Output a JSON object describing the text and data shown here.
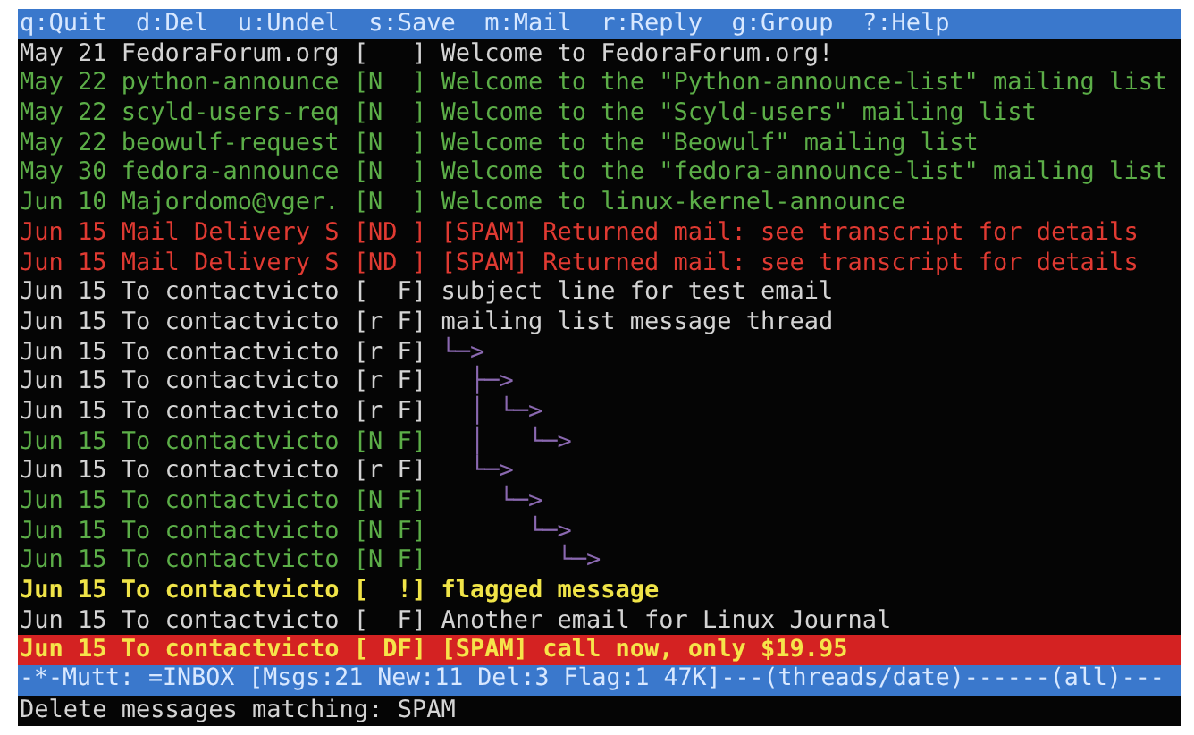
{
  "help_bar": [
    "q:Quit",
    "d:Del",
    "u:Undel",
    "s:Save",
    "m:Mail",
    "r:Reply",
    "g:Group",
    "?:Help"
  ],
  "messages": [
    {
      "date": "May 21",
      "from": "FedoraForum.org",
      "flags": "[   ]",
      "subject": "Welcome to FedoraForum.org!",
      "kind": "normal",
      "selected": false
    },
    {
      "date": "May 22",
      "from": "python-announce",
      "flags": "[N  ]",
      "subject": "Welcome to the \"Python-announce-list\" mailing list",
      "kind": "new",
      "selected": false
    },
    {
      "date": "May 22",
      "from": "scyld-users-req",
      "flags": "[N  ]",
      "subject": "Welcome to the \"Scyld-users\" mailing list",
      "kind": "new",
      "selected": false
    },
    {
      "date": "May 22",
      "from": "beowulf-request",
      "flags": "[N  ]",
      "subject": "Welcome to the \"Beowulf\" mailing list",
      "kind": "new",
      "selected": false
    },
    {
      "date": "May 30",
      "from": "fedora-announce",
      "flags": "[N  ]",
      "subject": "Welcome to the \"fedora-announce-list\" mailing list",
      "kind": "new",
      "selected": false
    },
    {
      "date": "Jun 10",
      "from": "Majordomo@vger.",
      "flags": "[N  ]",
      "subject": "Welcome to linux-kernel-announce",
      "kind": "new",
      "selected": false
    },
    {
      "date": "Jun 15",
      "from": "Mail Delivery S",
      "flags": "[ND ]",
      "subject": "[SPAM] Returned mail: see transcript for details",
      "kind": "deleted",
      "selected": false
    },
    {
      "date": "Jun 15",
      "from": "Mail Delivery S",
      "flags": "[ND ]",
      "subject": "[SPAM] Returned mail: see transcript for details",
      "kind": "deleted",
      "selected": false
    },
    {
      "date": "Jun 15",
      "from": "To contactvicto",
      "flags": "[  F]",
      "subject": "subject line for test email",
      "kind": "normal",
      "selected": false
    },
    {
      "date": "Jun 15",
      "from": "To contactvicto",
      "flags": "[r F]",
      "subject": "mailing list message thread",
      "kind": "normal",
      "selected": false
    },
    {
      "date": "Jun 15",
      "from": "To contactvicto",
      "flags": "[r F]",
      "tree": "└─>",
      "kind": "normal",
      "selected": false
    },
    {
      "date": "Jun 15",
      "from": "To contactvicto",
      "flags": "[r F]",
      "tree": "  ├─>",
      "kind": "normal",
      "selected": false
    },
    {
      "date": "Jun 15",
      "from": "To contactvicto",
      "flags": "[r F]",
      "tree": "  │ └─>",
      "kind": "normal",
      "selected": false
    },
    {
      "date": "Jun 15",
      "from": "To contactvicto",
      "flags": "[N F]",
      "tree": "  │   └─>",
      "kind": "new",
      "selected": false
    },
    {
      "date": "Jun 15",
      "from": "To contactvicto",
      "flags": "[r F]",
      "tree": "  └─>",
      "kind": "normal",
      "selected": false
    },
    {
      "date": "Jun 15",
      "from": "To contactvicto",
      "flags": "[N F]",
      "tree": "    └─>",
      "kind": "new",
      "selected": false
    },
    {
      "date": "Jun 15",
      "from": "To contactvicto",
      "flags": "[N F]",
      "tree": "      └─>",
      "kind": "new",
      "selected": false
    },
    {
      "date": "Jun 15",
      "from": "To contactvicto",
      "flags": "[N F]",
      "tree": "        └─>",
      "kind": "new",
      "selected": false
    },
    {
      "date": "Jun 15",
      "from": "To contactvicto",
      "flags": "[  !]",
      "subject": "flagged message",
      "kind": "flagged",
      "selected": false
    },
    {
      "date": "Jun 15",
      "from": "To contactvicto",
      "flags": "[  F]",
      "subject": "Another email for Linux Journal",
      "kind": "normal",
      "selected": false
    },
    {
      "date": "Jun 15",
      "from": "To contactvicto",
      "flags": "[ DF]",
      "subject": "[SPAM] call now, only $19.95",
      "kind": "deleted",
      "selected": true
    }
  ],
  "status_bar": "-*-Mutt: =INBOX [Msgs:21 New:11 Del:3 Flag:1 47K]---(threads/date)------(all)---",
  "command_line": "Delete messages matching: SPAM"
}
